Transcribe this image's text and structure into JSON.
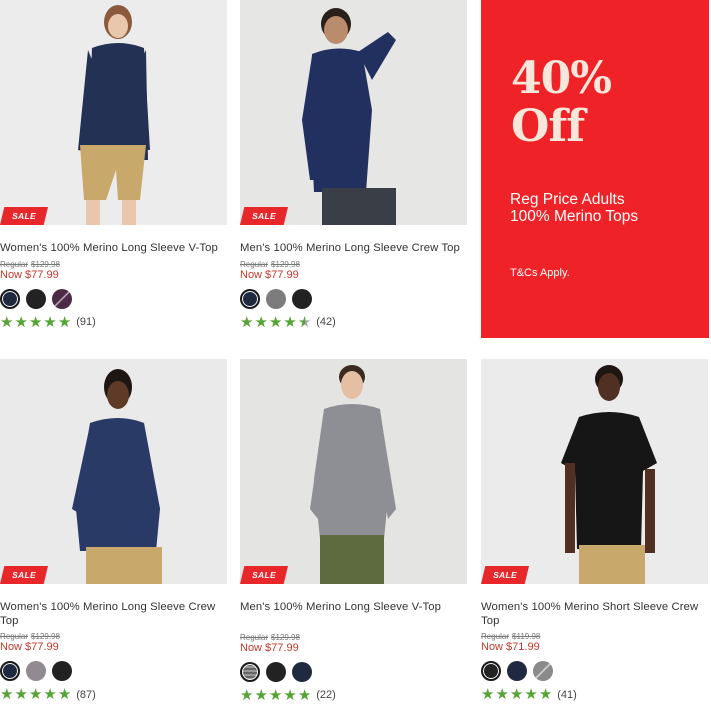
{
  "promo": {
    "headline_1": "40%",
    "headline_2": "Off",
    "sub_1": "Reg Price Adults",
    "sub_2": "100% Merino Tops",
    "terms": "T&Cs Apply.",
    "background": "#ef2327"
  },
  "products": [
    {
      "title": "Women's 100% Merino Long Sleeve V-Top",
      "badge": "SALE",
      "regular_label": "Regular",
      "regular_price": "$129.98",
      "now_price": "Now $77.99",
      "rating": 5,
      "review_count": "(91)",
      "swatches": [
        "navy",
        "black",
        "plum-stripe"
      ]
    },
    {
      "title": "Men's 100% Merino Long Sleeve Crew Top",
      "badge": "SALE",
      "regular_label": "Regular",
      "regular_price": "$129.98",
      "now_price": "Now $77.99",
      "rating": 4.5,
      "review_count": "(42)",
      "swatches": [
        "navy",
        "grey",
        "black"
      ]
    },
    {
      "title": "Women's 100% Merino Long Sleeve Crew Top",
      "badge": "SALE",
      "regular_label": "Regular",
      "regular_price": "$129.98",
      "now_price": "Now $77.99",
      "rating": 5,
      "review_count": "(87)",
      "swatches": [
        "navy",
        "grey",
        "black"
      ]
    },
    {
      "title": "Men's 100% Merino Long Sleeve V-Top",
      "badge": "SALE",
      "regular_label": "Regular",
      "regular_price": "$129.98",
      "now_price": "Now $77.99",
      "rating": 5,
      "review_count": "(22)",
      "swatches": [
        "grey-pattern",
        "black",
        "navy"
      ]
    },
    {
      "title": "Women's 100% Merino Short Sleeve Crew Top",
      "badge": "SALE",
      "regular_label": "Regular",
      "regular_price": "$119.98",
      "now_price": "Now $71.99",
      "rating": 5,
      "review_count": "(41)",
      "swatches": [
        "black",
        "navy",
        "grey-stripe"
      ]
    }
  ]
}
